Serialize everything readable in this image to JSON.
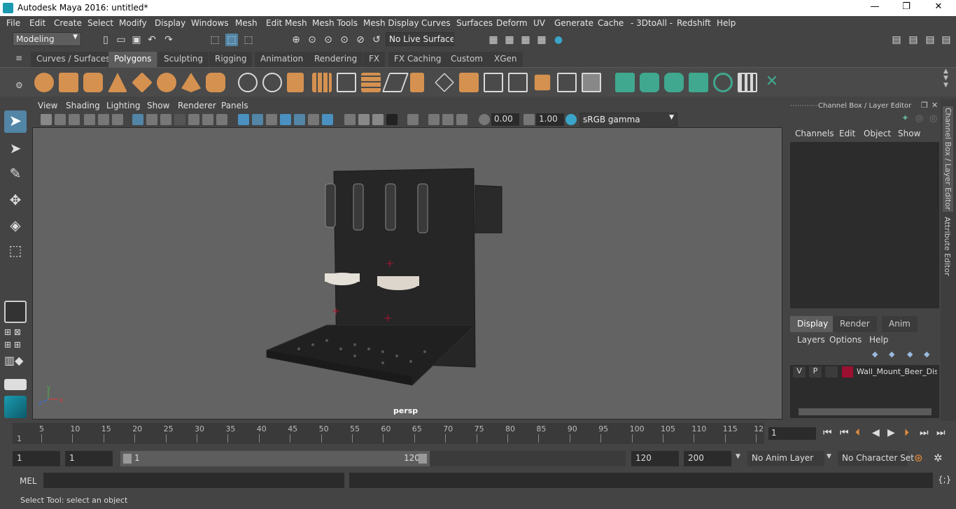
{
  "window": {
    "title": "Autodesk Maya 2016: untitled*",
    "minimize": "—",
    "restore": "❐",
    "close": "✕"
  },
  "menus": [
    "File",
    "Edit",
    "Create",
    "Select",
    "Modify",
    "Display",
    "Windows",
    "Mesh",
    "Edit Mesh",
    "Mesh Tools",
    "Mesh Display",
    "Curves",
    "Surfaces",
    "Deform",
    "UV",
    "Generate",
    "Cache",
    "- 3DtoAll -",
    "Redshift",
    "Help"
  ],
  "statusline": {
    "mode": "Modeling",
    "live_surface": "No Live Surface"
  },
  "shelf_tabs": [
    "Curves / Surfaces",
    "Polygons",
    "Sculpting",
    "Rigging",
    "Animation",
    "Rendering",
    "FX",
    "FX Caching",
    "Custom",
    "XGen"
  ],
  "active_shelf": "Polygons",
  "viewport": {
    "menus": [
      "View",
      "Shading",
      "Lighting",
      "Show",
      "Renderer",
      "Panels"
    ],
    "exposure": "0.00",
    "gamma": "1.00",
    "color_space": "sRGB gamma",
    "camera_label": "persp",
    "axis_x": "x",
    "axis_y": "y",
    "axis_z": "z"
  },
  "channel_box": {
    "title": "Channel Box / Layer Editor",
    "menus": [
      "Channels",
      "Edit",
      "Object",
      "Show"
    ]
  },
  "layer_editor": {
    "tabs": [
      "Display",
      "Render",
      "Anim"
    ],
    "active_tab": "Display",
    "menus": [
      "Layers",
      "Options",
      "Help"
    ],
    "layer": {
      "v": "V",
      "p": "P",
      "name": "Wall_Mount_Beer_Disp",
      "color": "#9b1030"
    }
  },
  "side_tabs": [
    "Channel Box / Layer Editor",
    "Attribute Editor"
  ],
  "time_slider": {
    "ticks": [
      "5",
      "10",
      "15",
      "20",
      "25",
      "30",
      "35",
      "40",
      "45",
      "50",
      "55",
      "60",
      "65",
      "70",
      "75",
      "80",
      "85",
      "90",
      "95",
      "100",
      "105",
      "110",
      "115",
      "12"
    ],
    "start_tick": "1",
    "current_frame": "1"
  },
  "range_slider": {
    "start": "1",
    "playback_start": "1",
    "range_start": "1",
    "range_end": "120",
    "playback_end": "120",
    "end": "200",
    "anim_layer": "No Anim Layer",
    "character_set": "No Character Set"
  },
  "command_line": {
    "label": "MEL"
  },
  "help_line": "Select Tool: select an object",
  "colors": {
    "bg": "#444444",
    "viewport": "#636363",
    "accent": "#5285a6",
    "shelf_orange": "#d59150",
    "shelf_green": "#3fa88f"
  }
}
